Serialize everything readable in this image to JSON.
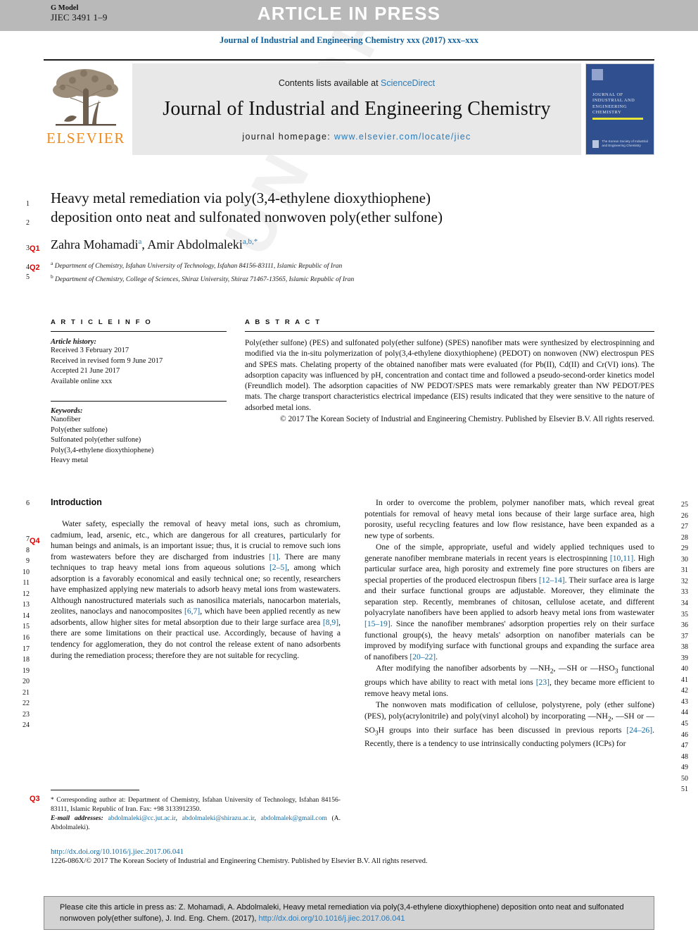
{
  "header": {
    "g_model_label": "G Model",
    "g_model_id": "JIEC 3491 1–9",
    "press_banner": "ARTICLE IN PRESS",
    "running_head": "Journal of Industrial and Engineering Chemistry xxx (2017) xxx–xxx"
  },
  "masthead": {
    "contents_prefix": "Contents lists available at ",
    "contents_link": "ScienceDirect",
    "journal_name": "Journal of Industrial and Engineering Chemistry",
    "homepage_prefix": "journal homepage: ",
    "homepage_link": "www.elsevier.com/locate/jiec",
    "publisher_wordmark": "ELSEVIER",
    "cover_title": "JOURNAL OF INDUSTRIAL AND ENGINEERING CHEMISTRY",
    "cover_footer": "The Korean Society of Industrial and Engineering Chemistry"
  },
  "article": {
    "title_line1": "Heavy metal remediation via poly(3,4-ethylene dioxythiophene)",
    "title_line2": "deposition onto neat and sulfonated nonwoven poly(ether sulfone)",
    "authors_plain": "Zahra Mohamadi",
    "author1_sup": "a",
    "authors_sep": ", Amir Abdolmaleki",
    "author2_sup": "a,b,*",
    "affiliation_a_marker": "a",
    "affiliation_a": "Department of Chemistry, Isfahan University of Technology, Isfahan 84156-83111, Islamic Republic of Iran",
    "affiliation_b_marker": "b",
    "affiliation_b": "Department of Chemistry, College of Sciences, Shiraz University, Shiraz 71467-13565, Islamic Republic of Iran"
  },
  "query_markers": {
    "q1": "Q1",
    "q2": "Q2",
    "q3": "Q3",
    "q4": "Q4"
  },
  "line_numbers": {
    "title_area": [
      "1",
      "2",
      "3",
      "4",
      "5"
    ],
    "left_column": [
      "6",
      "7",
      "8",
      "9",
      "10",
      "11",
      "12",
      "13",
      "14",
      "15",
      "16",
      "17",
      "18",
      "19",
      "20",
      "21",
      "22",
      "23",
      "24"
    ],
    "right_column": [
      "25",
      "26",
      "27",
      "28",
      "29",
      "30",
      "31",
      "32",
      "33",
      "34",
      "35",
      "36",
      "37",
      "38",
      "39",
      "40",
      "41",
      "42",
      "43",
      "44",
      "45",
      "46",
      "47",
      "48",
      "49",
      "50",
      "51"
    ]
  },
  "article_info": {
    "heading": "A R T I C L E   I N F O",
    "history_label": "Article history:",
    "history": [
      "Received 3 February 2017",
      "Received in revised form 9 June 2017",
      "Accepted 21 June 2017",
      "Available online xxx"
    ],
    "keywords_label": "Keywords:",
    "keywords": [
      "Nanofiber",
      "Poly(ether sulfone)",
      "Sulfonated poly(ether sulfone)",
      "Poly(3,4-ethylene dioxythiophene)",
      "Heavy metal"
    ]
  },
  "abstract": {
    "heading": "A B S T R A C T",
    "body": "Poly(ether sulfone) (PES) and sulfonated poly(ether sulfone) (SPES) nanofiber mats were synthesized by electrospinning and modified via the in-situ polymerization of poly(3,4-ethylene dioxythiophene) (PEDOT) on nonwoven (NW) electrospun PES and SPES mats. Chelating property of the obtained nanofiber mats were evaluated (for Pb(II), Cd(II) and Cr(VI) ions). The adsorption capacity was influenced by pH, concentration and contact time and followed a pseudo-second-order kinetics model (Freundlich model). The adsorption capacities of NW PEDOT/SPES mats were remarkably greater than NW PEDOT/PES mats. The charge transport characteristics electrical impedance (EIS) results indicated that they were sensitive to the nature of adsorbed metal ions.",
    "copyright": "© 2017 The Korean Society of Industrial and Engineering Chemistry. Published by Elsevier B.V. All rights reserved."
  },
  "body": {
    "section_heading": "Introduction",
    "left_paragraphs": [
      "Water safety, especially the removal of heavy metal ions, such as chromium, cadmium, lead, arsenic, etc., which are dangerous for all creatures, particularly for human beings and animals, is an important issue; thus, it is crucial to remove such ions from wastewaters before they are discharged from industries [1]. There are many techniques to trap heavy metal ions from aqueous solutions [2–5], among which adsorption is a favorably economical and easily technical one; so recently, researchers have emphasized applying new materials to adsorb heavy metal ions from wastewaters. Although nanostructured materials such as nanosilica materials, nanocarbon materials, zeolites, nanoclays and nanocomposites [6,7], which have been applied recently as new adsorbents, allow higher sites for metal absorption due to their large surface area [8,9], there are some limitations on their practical use. Accordingly, because of having a tendency for agglomeration, they do not control the release extent of nano adsorbents during the remediation process; therefore they are not suitable for recycling."
    ],
    "right_paragraphs": [
      "In order to overcome the problem, polymer nanofiber mats, which reveal great potentials for removal of heavy metal ions because of their large surface area, high porosity, useful recycling features and low flow resistance, have been expanded as a new type of sorbents.",
      "One of the simple, appropriate, useful and widely applied techniques used to generate nanofiber membrane materials in recent years is electrospinning [10,11]. High particular surface area, high porosity and extremely fine pore structures on fibers are special properties of the produced electrospun fibers [12–14]. Their surface area is large and their surface functional groups are adjustable. Moreover, they eliminate the separation step. Recently, membranes of chitosan, cellulose acetate, and different polyacrylate nanofibers have been applied to adsorb heavy metal ions from wastewater [15–19]. Since the nanofiber membranes' adsorption properties rely on their surface functional group(s), the heavy metals' adsorption on nanofiber materials can be improved by modifying surface with functional groups and expanding the surface area of nanofibers [20–22].",
      "After modifying the nanofiber adsorbents by —NH2, —SH or —HSO3 functional groups which have ability to react with metal ions [23], they became more efficient to remove heavy metal ions.",
      "The nonwoven mats modification of cellulose, polystyrene, poly (ether sulfone) (PES), poly(acrylonitrile) and poly(vinyl alcohol) by incorporating —NH2, —SH or —SO3H groups into their surface has been discussed in previous reports [24–26]. Recently, there is a tendency to use intrinsically conducting polymers (ICPs) for"
    ]
  },
  "footnote": {
    "corresponding": "* Corresponding author at: Department of Chemistry, Isfahan University of Technology, Isfahan 84156-83111, Islamic Republic of Iran. Fax: +98 3133912350.",
    "email_label": "E-mail addresses:",
    "email1": "abdolmaleki@cc.jut.ac.ir",
    "email2": "abdolmaleki@shirazu.ac.ir",
    "email3": "abdolmalek@gmail.com",
    "email_suffix": "(A. Abdolmaleki).",
    "doi": "http://dx.doi.org/10.1016/j.jiec.2017.06.041",
    "issn_line": "1226-086X/© 2017 The Korean Society of Industrial and Engineering Chemistry. Published by Elsevier B.V. All rights reserved."
  },
  "cite_box": {
    "line1": "Please cite this article in press as: Z. Mohamadi, A. Abdolmaleki, Heavy metal remediation via poly(3,4-ethylene dioxythiophene) deposition",
    "line2_prefix": "onto neat and sulfonated nonwoven poly(ether sulfone), J. Ind. Eng. Chem. (2017), ",
    "line2_link": "http://dx.doi.org/10.1016/j.jiec.2017.06.041"
  },
  "watermark": {
    "text": "UNCORRECTED PROOF"
  },
  "colors": {
    "link_blue": "#2b7bb9",
    "ref_blue": "#15699f",
    "query_red": "#e00000",
    "elsevier_orange": "#f08a1b",
    "band_gray": "#b9b9b9",
    "cover_blue": "#2f4f8f"
  }
}
